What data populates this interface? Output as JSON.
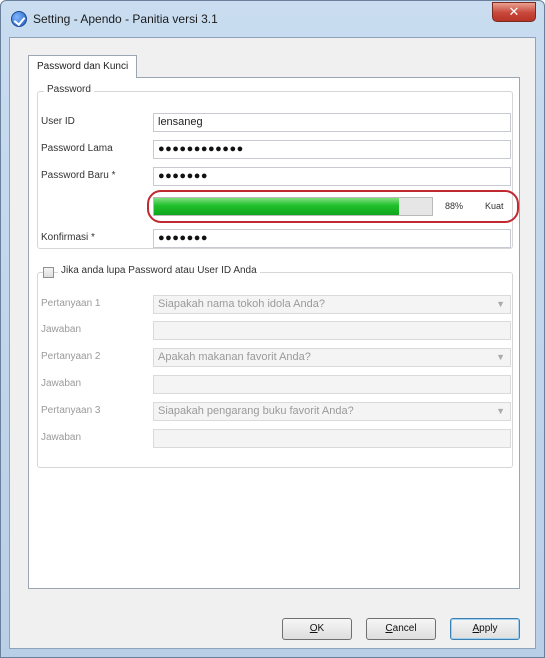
{
  "window": {
    "title": "Setting - Apendo - Panitia versi 3.1",
    "close_label": "✕"
  },
  "tabs": [
    {
      "label": "Password dan Kunci",
      "selected": true
    }
  ],
  "password_group": {
    "legend": "Password",
    "user_id": {
      "label": "User ID",
      "value": "lensaneg"
    },
    "old_password": {
      "label": "Password Lama",
      "value": "●●●●●●●●●●●●"
    },
    "new_password": {
      "label": "Password Baru *",
      "value": "●●●●●●●"
    },
    "strength": {
      "percent": 0.88,
      "percent_label": "88%",
      "label": "Kuat",
      "color": "#1fbf2a"
    },
    "confirm": {
      "label": "Konfirmasi *",
      "value": "●●●●●●●"
    }
  },
  "recovery_group": {
    "legend": "Jika anda lupa Password atau User ID Anda",
    "checked": false,
    "q1": {
      "label": "Pertanyaan 1",
      "value": "Siapakah nama tokoh idola Anda?"
    },
    "a1": {
      "label": "Jawaban",
      "value": ""
    },
    "q2": {
      "label": "Pertanyaan 2",
      "value": "Apakah makanan favorit Anda?"
    },
    "a2": {
      "label": "Jawaban",
      "value": ""
    },
    "q3": {
      "label": "Pertanyaan 3",
      "value": "Siapakah pengarang buku favorit Anda?"
    },
    "a3": {
      "label": "Jawaban",
      "value": ""
    }
  },
  "buttons": {
    "ok": {
      "hotkey": "O",
      "rest": "K"
    },
    "cancel": {
      "hotkey": "C",
      "rest": "ancel"
    },
    "apply": {
      "hotkey": "A",
      "rest": "pply"
    }
  },
  "colors": {
    "highlight": "#c0292f",
    "accent": "#3c7fb1"
  }
}
